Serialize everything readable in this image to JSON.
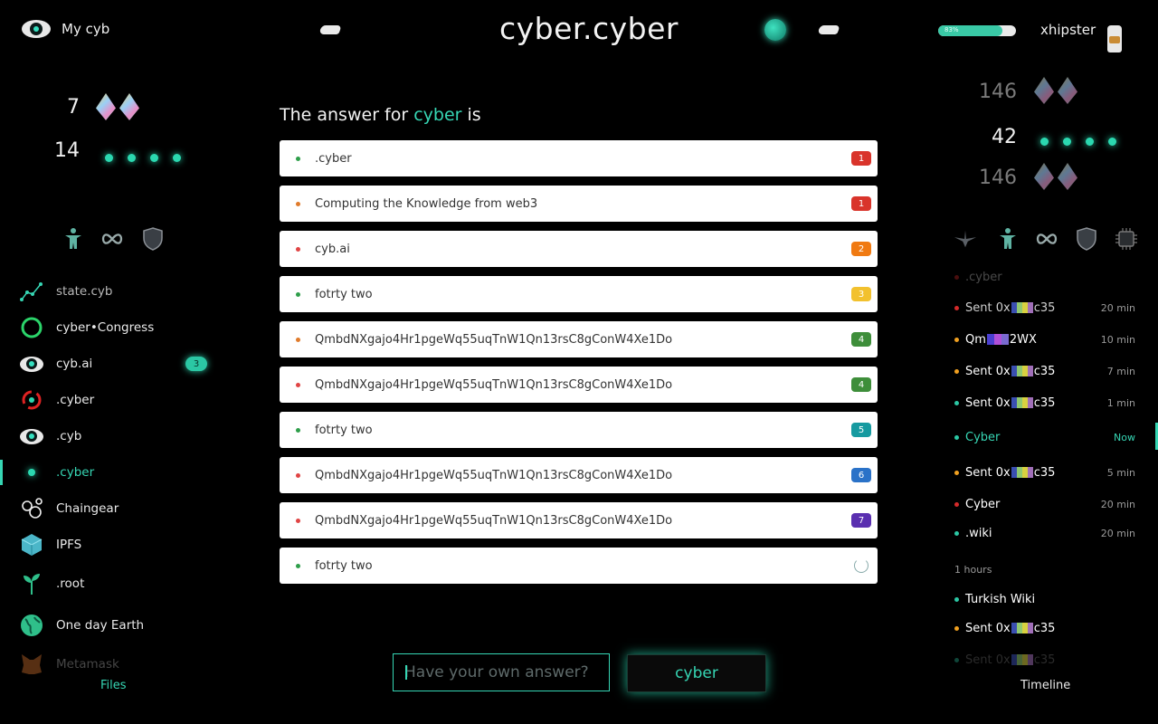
{
  "header": {
    "my_label": "My cyb",
    "title": "cyber.cyber",
    "progress_text": "83%",
    "progress_value": 0.83,
    "user": "xhipster"
  },
  "left_stats": [
    {
      "value": "7"
    },
    {
      "value": "14"
    }
  ],
  "menu": [
    {
      "label": "state.cyb",
      "icon": "chart-icon"
    },
    {
      "label": "cyber•Congress",
      "icon": "ring-icon"
    },
    {
      "label": "cyb.ai",
      "icon": "eye-icon",
      "badge": "3"
    },
    {
      "label": ".cyber",
      "icon": "orbit-icon"
    },
    {
      "label": ".cyb",
      "icon": "eye-icon"
    },
    {
      "label": ".cyber",
      "icon": "dot-icon"
    },
    {
      "label": "Chaingear",
      "icon": "gears-icon"
    },
    {
      "label": "IPFS",
      "icon": "cube-icon"
    },
    {
      "label": ".root",
      "icon": "sprout-icon"
    },
    {
      "label": "One day Earth",
      "icon": "earth-icon"
    },
    {
      "label": "Metamask",
      "icon": "fox-icon"
    }
  ],
  "left_footer": "Files",
  "main": {
    "heading_prefix": "The answer for",
    "heading_query": "cyber",
    "heading_suffix": "is",
    "results": [
      {
        "text": ".cyber",
        "rank": "1",
        "bullet": "#2e9e4a",
        "rank_color": "#d9342b"
      },
      {
        "text": "Computing the Knowledge from web3",
        "rank": "1",
        "bullet": "#e07b2b",
        "rank_color": "#d9342b"
      },
      {
        "text": "cyb.ai",
        "rank": "2",
        "bullet": "#e04444",
        "rank_color": "#f07a12"
      },
      {
        "text": "fotrty two",
        "rank": "3",
        "bullet": "#2e9e4a",
        "rank_color": "#f2c12e"
      },
      {
        "text": "QmbdNXgajo4Hr1pgeWq55uqTnW1Qn13rsC8gConW4Xe1Do",
        "rank": "4",
        "bullet": "#e07b2b",
        "rank_color": "#3e8e3a"
      },
      {
        "text": "QmbdNXgajo4Hr1pgeWq55uqTnW1Qn13rsC8gConW4Xe1Do",
        "rank": "4",
        "bullet": "#e04444",
        "rank_color": "#3e8e3a"
      },
      {
        "text": "fotrty two",
        "rank": "5",
        "bullet": "#2e9e4a",
        "rank_color": "#169aa0"
      },
      {
        "text": "QmbdNXgajo4Hr1pgeWq55uqTnW1Qn13rsC8gConW4Xe1Do",
        "rank": "6",
        "bullet": "#e04444",
        "rank_color": "#2a72c8"
      },
      {
        "text": "QmbdNXgajo4Hr1pgeWq55uqTnW1Qn13rsC8gConW4Xe1Do",
        "rank": "7",
        "bullet": "#e04444",
        "rank_color": "#5a2fb0"
      },
      {
        "text": "fotrty two",
        "rank": "",
        "bullet": "#2e9e4a",
        "rank_color": ""
      }
    ],
    "input_placeholder": "Have your own answer?",
    "submit_label": "cyber"
  },
  "right_stats": [
    {
      "value": "146",
      "dim": true
    },
    {
      "value": "42",
      "dim": false
    },
    {
      "value": "146",
      "dim": true
    }
  ],
  "timeline": {
    "top_label": ".cyber",
    "items": [
      {
        "pre": "Sent",
        "addr": "0x",
        "suf": "c35",
        "time": "20 min",
        "bullet": "#d42a2a",
        "color": "#cfcfcf"
      },
      {
        "pre": "",
        "addr": "Qm",
        "suf": "2WX",
        "time": "10 min",
        "bullet": "#f0a020",
        "color": "#ffffff"
      },
      {
        "pre": "Sent",
        "addr": "0x",
        "suf": "c35",
        "time": "7 min",
        "bullet": "#f0a020",
        "color": "#ffffff"
      },
      {
        "pre": "Sent",
        "addr": "0x",
        "suf": "c35",
        "time": "1 min",
        "bullet": "#2bc7a4",
        "color": "#ffffff"
      },
      {
        "pre": "Cyber",
        "addr": "",
        "suf": "",
        "time": "Now",
        "bullet": "#2bc7a4",
        "color": "#36d6b4"
      },
      {
        "pre": "Sent",
        "addr": "0x",
        "suf": "c35",
        "time": "5 min",
        "bullet": "#f0a020",
        "color": "#ffffff"
      },
      {
        "pre": "Cyber",
        "addr": "",
        "suf": "",
        "time": "20 min",
        "bullet": "#d42a2a",
        "color": "#ffffff"
      },
      {
        "pre": ".wiki",
        "addr": "",
        "suf": "",
        "time": "20 min",
        "bullet": "#2bc7a4",
        "color": "#ffffff"
      }
    ],
    "group_label": "1 hours",
    "items2": [
      {
        "pre": "Turkish Wiki",
        "addr": "",
        "suf": "",
        "time": "",
        "bullet": "#2bc7a4",
        "color": "#ffffff"
      },
      {
        "pre": "Sent",
        "addr": "0x",
        "suf": "c35",
        "time": "",
        "bullet": "#f0a020",
        "color": "#ffffff"
      },
      {
        "pre": "Sent",
        "addr": "0x",
        "suf": "c35",
        "time": "",
        "bullet": "#1f8a72",
        "color": "#555555"
      }
    ],
    "footer": "Timeline"
  },
  "colors": {
    "accent": "#36d6b4",
    "background": "#000000"
  }
}
